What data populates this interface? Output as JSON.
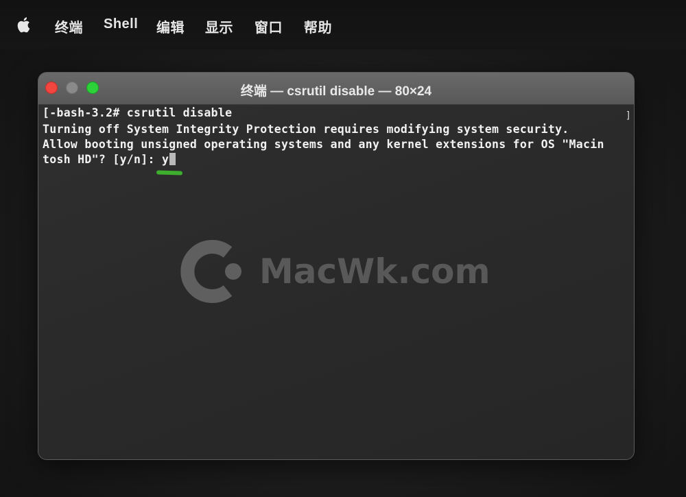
{
  "menubar": {
    "apple_icon": "apple-logo-icon",
    "items": [
      {
        "label": "终端"
      },
      {
        "label": "Shell"
      },
      {
        "label": "编辑"
      },
      {
        "label": "显示"
      },
      {
        "label": "窗口"
      },
      {
        "label": "帮助"
      }
    ]
  },
  "window": {
    "title": "终端 — csrutil disable — 80×24",
    "traffic_lights": {
      "close": "#f2463f",
      "minimize": "#8a8a8a",
      "zoom": "#2dd23a"
    }
  },
  "terminal": {
    "lines": [
      "[-bash-3.2# csrutil disable",
      "Turning off System Integrity Protection requires modifying system security.",
      "Allow booting unsigned operating systems and any kernel extensions for OS \"Macin",
      "tosh HD\"? [y/n]: y"
    ],
    "scroll_indicator": "]",
    "highlight_color": "#3eae2f"
  },
  "watermark": {
    "text": "MacWk.com"
  }
}
